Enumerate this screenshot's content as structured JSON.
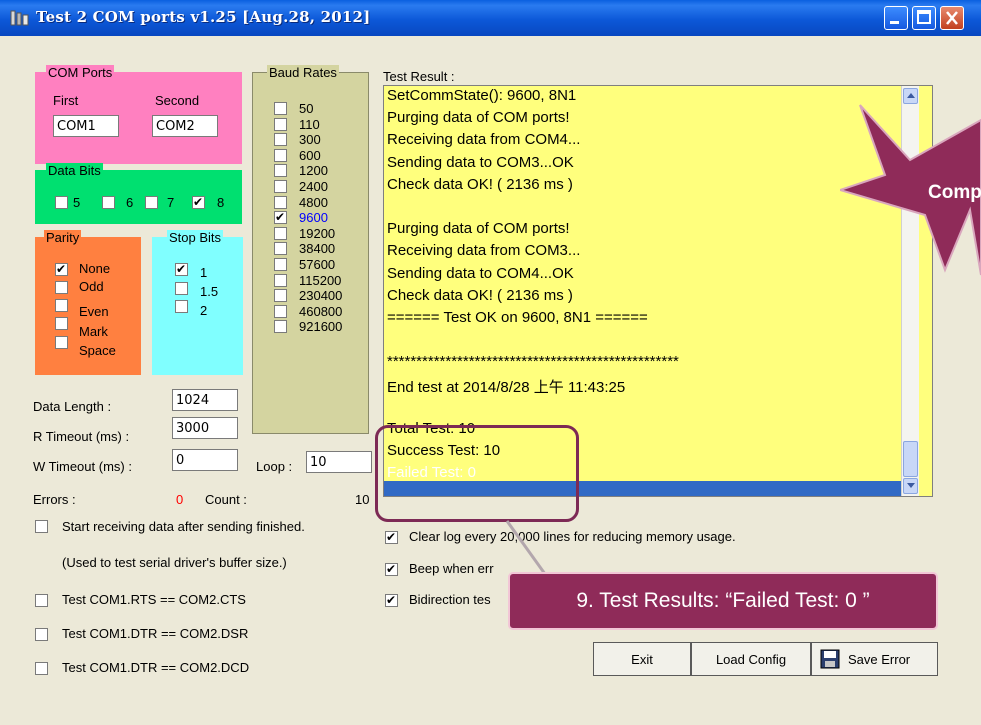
{
  "window": {
    "title": "Test 2 COM ports v1.25 [Aug.28, 2012]",
    "colors": {
      "titlebar": "#0a5fe0",
      "client": "#ece9d8"
    }
  },
  "com_ports": {
    "label": "COM Ports",
    "first_label": "First",
    "second_label": "Second",
    "first_value": "COM1",
    "second_value": "COM2",
    "color": "#ff80c0"
  },
  "data_bits": {
    "label": "Data Bits",
    "options": [
      {
        "label": "5",
        "checked": false
      },
      {
        "label": "6",
        "checked": false
      },
      {
        "label": "7",
        "checked": false
      },
      {
        "label": "8",
        "checked": true
      }
    ],
    "color": "#00e070"
  },
  "parity": {
    "label": "Parity",
    "options": [
      {
        "label": "None",
        "checked": true
      },
      {
        "label": "Odd",
        "checked": false
      },
      {
        "label": "Even",
        "checked": false
      },
      {
        "label": "Mark",
        "checked": false
      },
      {
        "label": "Space",
        "checked": false
      }
    ],
    "color": "#ff8040"
  },
  "stop_bits": {
    "label": "Stop Bits",
    "options": [
      {
        "label": "1",
        "checked": true
      },
      {
        "label": "1.5",
        "checked": false
      },
      {
        "label": "2",
        "checked": false
      }
    ],
    "color": "#80ffff"
  },
  "baud_rates": {
    "label": "Baud Rates",
    "options": [
      {
        "label": "50",
        "checked": false
      },
      {
        "label": "110",
        "checked": false
      },
      {
        "label": "300",
        "checked": false
      },
      {
        "label": "600",
        "checked": false
      },
      {
        "label": "1200",
        "checked": false
      },
      {
        "label": "2400",
        "checked": false
      },
      {
        "label": "4800",
        "checked": false
      },
      {
        "label": "9600",
        "checked": true
      },
      {
        "label": "19200",
        "checked": false
      },
      {
        "label": "38400",
        "checked": false
      },
      {
        "label": "57600",
        "checked": false
      },
      {
        "label": "115200",
        "checked": false
      },
      {
        "label": "230400",
        "checked": false
      },
      {
        "label": "460800",
        "checked": false
      },
      {
        "label": "921600",
        "checked": false
      }
    ],
    "color": "#d4d4a0",
    "selected_color": "#0000ff"
  },
  "params": {
    "data_length_label": "Data Length :",
    "data_length_value": "1024",
    "r_timeout_label": "R Timeout (ms) :",
    "r_timeout_value": "3000",
    "w_timeout_label": "W Timeout (ms) :",
    "w_timeout_value": "0",
    "loop_label": "Loop :",
    "loop_value": "10"
  },
  "counters": {
    "errors_label": "Errors :",
    "errors_value": "0",
    "count_label": "Count :",
    "count_value": "10",
    "errors_color": "#ff0000"
  },
  "options": {
    "start_receiving": "Start receiving data after sending finished.",
    "start_receiving_note": "(Used to test serial driver's buffer size.)",
    "rts_cts": "Test COM1.RTS == COM2.CTS",
    "dtr_dsr": "Test COM1.DTR == COM2.DSR",
    "dtr_dcd": "Test COM1.DTR == COM2.DCD",
    "clear_log": "Clear log every 20,000  lines for reducing memory usage.",
    "beep_when": "Beep when err",
    "bidirection": "Bidirection tes"
  },
  "test_result": {
    "label": "Test Result :",
    "lines": [
      "SetCommState(): 9600, 8N1",
      "Purging data of COM ports!",
      "Receiving data from COM4...",
      "Sending data to COM3...OK",
      "Check data OK! ( 2136 ms )",
      "",
      "Purging data of COM ports!",
      "Receiving data from COM3...",
      "Sending data to COM4...OK",
      "Check data OK! ( 2136 ms )",
      "====== Test OK on 9600, 8N1 ======",
      "",
      "**************************************************",
      "End test at 2014/8/28 上午 11:43:25",
      "",
      "Total Test: 10",
      "Success Test: 10",
      "Failed Test: 0"
    ],
    "background": "#ffff80",
    "selected_color": "#316ac5"
  },
  "buttons": {
    "exit": "Exit",
    "load_config": "Load Config",
    "save_error": "Save Error"
  },
  "annotations": {
    "star_text": "Comp",
    "callout_text": "9. Test Results: “Failed Test: 0 ”",
    "color": "#8f2b59"
  }
}
